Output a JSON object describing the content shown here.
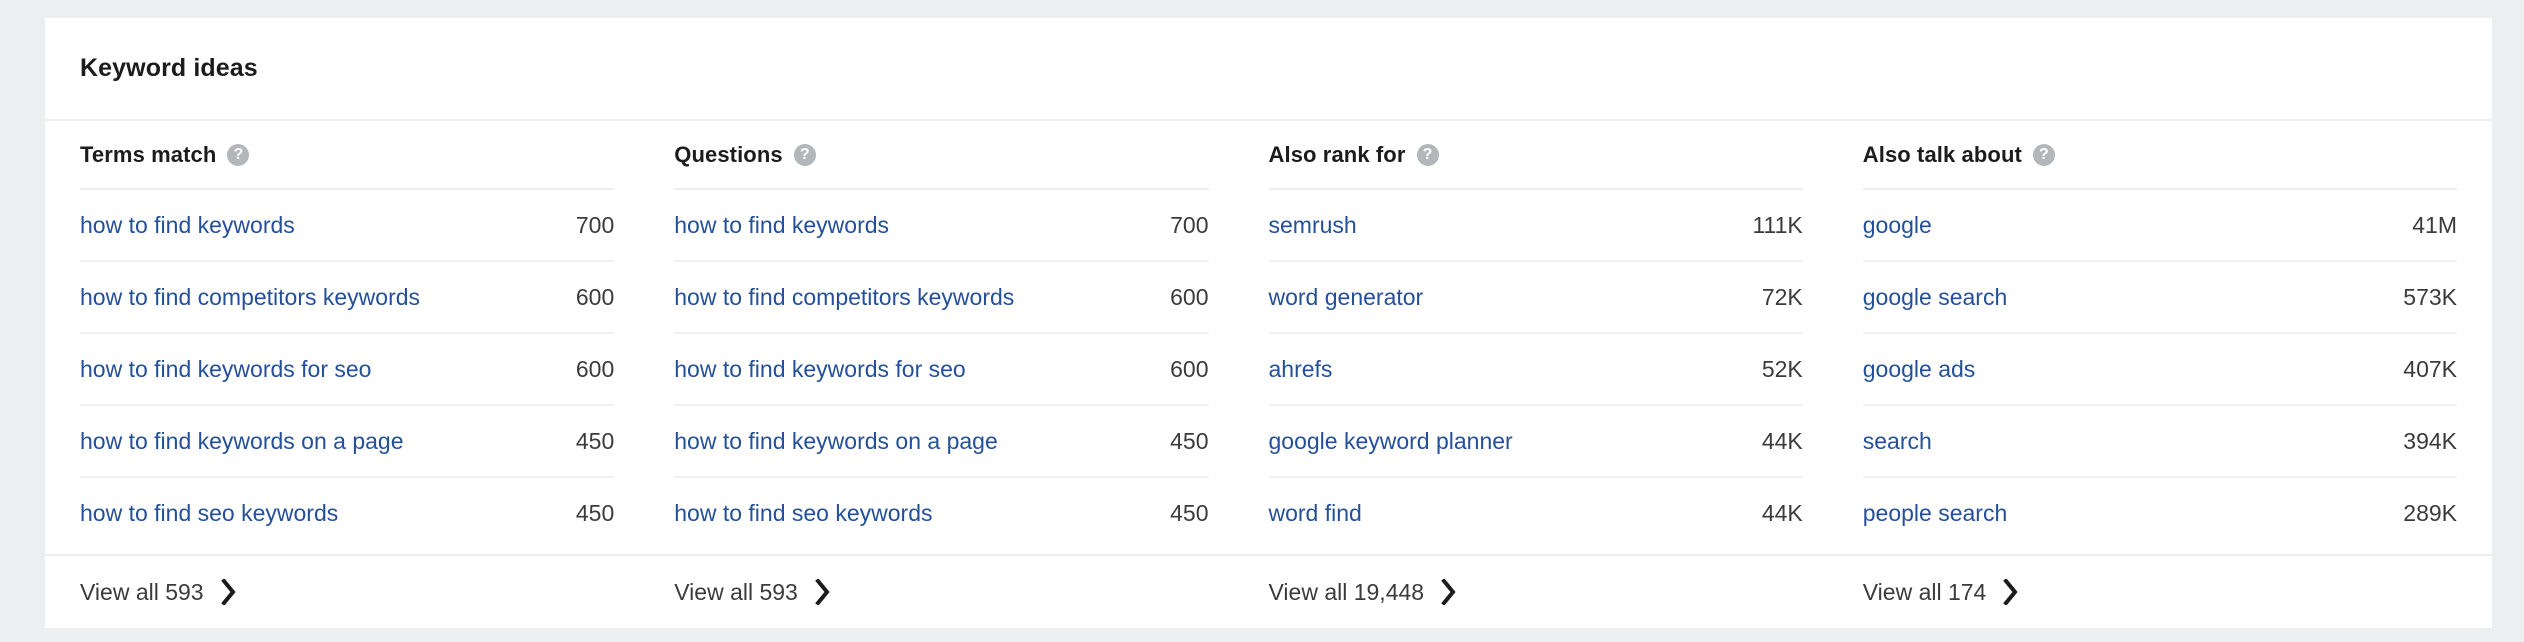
{
  "card": {
    "title": "Keyword ideas"
  },
  "help_icon_glyph": "?",
  "columns": [
    {
      "header": "Terms match",
      "help_icon": "help-circle-icon",
      "rows": [
        {
          "keyword": "how to find keywords",
          "volume": "700"
        },
        {
          "keyword": "how to find competitors keywords",
          "volume": "600"
        },
        {
          "keyword": "how to find keywords for seo",
          "volume": "600"
        },
        {
          "keyword": "how to find keywords on a page",
          "volume": "450"
        },
        {
          "keyword": "how to find seo keywords",
          "volume": "450"
        }
      ],
      "view_all": "View all 593"
    },
    {
      "header": "Questions",
      "help_icon": "help-circle-icon",
      "rows": [
        {
          "keyword": "how to find keywords",
          "volume": "700"
        },
        {
          "keyword": "how to find competitors keywords",
          "volume": "600"
        },
        {
          "keyword": "how to find keywords for seo",
          "volume": "600"
        },
        {
          "keyword": "how to find keywords on a page",
          "volume": "450"
        },
        {
          "keyword": "how to find seo keywords",
          "volume": "450"
        }
      ],
      "view_all": "View all 593"
    },
    {
      "header": "Also rank for",
      "help_icon": "help-circle-icon",
      "rows": [
        {
          "keyword": "semrush",
          "volume": "111K"
        },
        {
          "keyword": "word generator",
          "volume": "72K"
        },
        {
          "keyword": "ahrefs",
          "volume": "52K"
        },
        {
          "keyword": "google keyword planner",
          "volume": "44K"
        },
        {
          "keyword": "word find",
          "volume": "44K"
        }
      ],
      "view_all": "View all 19,448"
    },
    {
      "header": "Also talk about",
      "help_icon": "help-circle-icon",
      "rows": [
        {
          "keyword": "google",
          "volume": "41M"
        },
        {
          "keyword": "google search",
          "volume": "573K"
        },
        {
          "keyword": "google ads",
          "volume": "407K"
        },
        {
          "keyword": "search",
          "volume": "394K"
        },
        {
          "keyword": "people search",
          "volume": "289K"
        }
      ],
      "view_all": "View all 174"
    }
  ],
  "colors": {
    "page_background": "#eceef0",
    "card_background": "#ffffff",
    "link": "#24509b",
    "text": "#1c1c1c",
    "value_text": "#3b3b3b",
    "divider": "#eceef0",
    "row_divider": "#f0f1f3",
    "help_icon": "#b4b7ba"
  }
}
